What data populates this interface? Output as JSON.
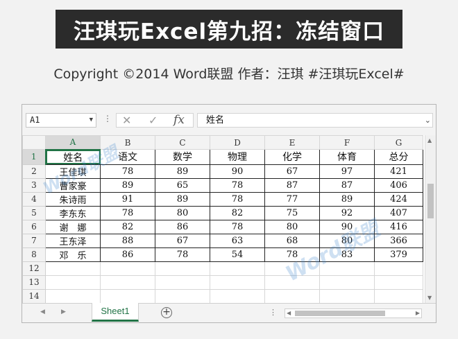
{
  "banner": {
    "title": "汪琪玩Excel第九招：冻结窗口",
    "copyright": "Copyright ©2014 Word联盟    作者：汪琪    #汪琪玩Excel#"
  },
  "excel": {
    "name_box": "A1",
    "formula_value": "姓名",
    "column_headers": [
      "A",
      "B",
      "C",
      "D",
      "E",
      "F",
      "G"
    ],
    "header_row": {
      "row_number": "1",
      "cells": [
        "姓名",
        "语文",
        "数学",
        "物理",
        "化学",
        "体育",
        "总分"
      ]
    },
    "data_rows": [
      {
        "row_number": "2",
        "cells": [
          "王佳琪",
          "78",
          "89",
          "90",
          "67",
          "97",
          "421"
        ]
      },
      {
        "row_number": "3",
        "cells": [
          "曹家豪",
          "89",
          "65",
          "78",
          "87",
          "87",
          "406"
        ]
      },
      {
        "row_number": "4",
        "cells": [
          "朱诗雨",
          "91",
          "89",
          "78",
          "77",
          "89",
          "424"
        ]
      },
      {
        "row_number": "5",
        "cells": [
          "李东东",
          "78",
          "80",
          "82",
          "75",
          "92",
          "407"
        ]
      },
      {
        "row_number": "6",
        "cells": [
          "谢　娜",
          "82",
          "86",
          "78",
          "80",
          "90",
          "416"
        ]
      },
      {
        "row_number": "7",
        "cells": [
          "王东泽",
          "88",
          "67",
          "63",
          "68",
          "80",
          "366"
        ]
      },
      {
        "row_number": "8",
        "cells": [
          "邓　乐",
          "86",
          "78",
          "54",
          "78",
          "83",
          "379"
        ]
      }
    ],
    "empty_rows": [
      "12",
      "13",
      "14"
    ],
    "sheet_tab": "Sheet1",
    "add_sheet_symbol": "⊕",
    "watermark": "Word联盟",
    "accent_color": "#217346"
  }
}
